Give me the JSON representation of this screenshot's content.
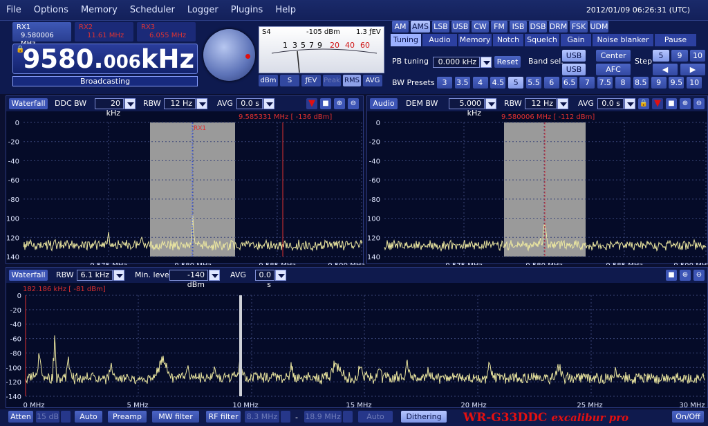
{
  "menu": [
    "File",
    "Options",
    "Memory",
    "Scheduler",
    "Logger",
    "Plugins",
    "Help"
  ],
  "clock": "2012/01/09 06:26:31 (UTC)",
  "receivers": [
    {
      "name": "RX1",
      "freq": "9.580006 MHz",
      "active": true
    },
    {
      "name": "RX2",
      "freq": "11.61 MHz",
      "active": false
    },
    {
      "name": "RX3",
      "freq": "6.055 MHz",
      "active": false
    }
  ],
  "frequency": {
    "main": "9580.",
    "fraction": "006",
    "unit": "kHz"
  },
  "mode_label": "Broadcasting",
  "smeter": {
    "s_reading": "S4",
    "dbm": "-105 dBm",
    "fev": "1.3 ƒEV",
    "scale": [
      "1",
      "3",
      "5",
      "7",
      "9",
      "20",
      "40",
      "60"
    ],
    "buttons": [
      {
        "label": "dBm",
        "state": "normal"
      },
      {
        "label": "S",
        "state": "normal"
      },
      {
        "label": "ƒEV",
        "state": "normal"
      },
      {
        "label": "Peak",
        "state": "dim"
      },
      {
        "label": "RMS",
        "state": "on"
      },
      {
        "label": "AVG",
        "state": "normal"
      }
    ]
  },
  "modes": [
    {
      "label": "AM",
      "on": false
    },
    {
      "label": "AMS",
      "on": true
    },
    {
      "label": "LSB",
      "on": false
    },
    {
      "label": "USB",
      "on": false
    },
    {
      "label": "CW",
      "on": false
    },
    {
      "label": "FM",
      "on": false
    },
    {
      "label": "ISB",
      "on": false
    },
    {
      "label": "DSB",
      "on": false
    },
    {
      "label": "DRM",
      "on": false
    },
    {
      "label": "FSK",
      "on": false
    },
    {
      "label": "UDM",
      "on": false
    }
  ],
  "tabs": [
    {
      "label": "Tuning",
      "on": true
    },
    {
      "label": "Audio",
      "on": false
    },
    {
      "label": "Memory",
      "on": false
    },
    {
      "label": "Notch",
      "on": false
    },
    {
      "label": "Squelch",
      "on": false
    },
    {
      "label": "Gain",
      "on": false
    },
    {
      "label": "Noise blanker",
      "on": false
    },
    {
      "label": "Pause",
      "on": false
    }
  ],
  "tuning": {
    "pb_label": "PB tuning",
    "pb_value": "0.000 kHz",
    "reset": "Reset",
    "bandsel_label": "Band sel.",
    "usb1": "USB",
    "usb2": "USB",
    "center": "Center",
    "afc": "AFC",
    "step_label": "Step",
    "steps": [
      "5",
      "9",
      "10"
    ],
    "left_arrow": "◀",
    "right_arrow": "▶",
    "bw_label": "BW Presets",
    "bw_presets": [
      "3",
      "3.5",
      "4",
      "4.5",
      "5",
      "5.5",
      "6",
      "6.5",
      "7",
      "7.5",
      "8",
      "8.5",
      "9",
      "9.5",
      "10"
    ],
    "bw_selected": "5"
  },
  "ddc_panel": {
    "waterfall": "Waterfall",
    "bw_label": "DDC BW",
    "bw_value": "20 kHz",
    "rbw_label": "RBW",
    "rbw_value": "12 Hz",
    "avg_label": "AVG",
    "avg_value": "0.0 s",
    "marker": "9.585331 MHz [ -136 dBm]",
    "tag": "RX1",
    "y_labels": [
      "0",
      "-20",
      "-40",
      "-60",
      "-80",
      "-100",
      "-120",
      "-140"
    ],
    "x_labels": [
      "9.575 MHz",
      "9.580 MHz",
      "9.585 MHz",
      "9.590 MHz"
    ]
  },
  "dem_panel": {
    "audio": "Audio",
    "bw_label": "DEM BW",
    "bw_value": "5.000 kHz",
    "rbw_label": "RBW",
    "rbw_value": "12 Hz",
    "avg_label": "AVG",
    "avg_value": "0.0 s",
    "marker": "9.580006 MHz [ -112 dBm]",
    "y_labels": [
      "0",
      "-20",
      "-40",
      "-60",
      "-80",
      "-100",
      "-120",
      "-140"
    ],
    "x_labels": [
      "9.575 MHz",
      "9.580 MHz",
      "9.585 MHz",
      "9.590 MHz"
    ]
  },
  "wide_panel": {
    "waterfall": "Waterfall",
    "rbw_label": "RBW",
    "rbw_value": "6.1 kHz",
    "min_label": "Min. level",
    "min_value": "-140 dBm",
    "avg_label": "AVG",
    "avg_value": "0.0 s",
    "marker": "182.186 kHz [ -81 dBm]",
    "y_labels": [
      "0",
      "-20",
      "-40",
      "-60",
      "-80",
      "-100",
      "-120",
      "-140"
    ],
    "x_labels": [
      "0 MHz",
      "5 MHz",
      "10 MHz",
      "15 MHz",
      "20 MHz",
      "25 MHz",
      "30 MHz"
    ]
  },
  "bottom": {
    "atten": "Atten",
    "atten_value": "15 dB",
    "auto": "Auto",
    "preamp": "Preamp",
    "mw": "MW filter",
    "rf": "RF filter",
    "rf_from": "8.3 MHz",
    "dash": "-",
    "rf_to": "18.9 MHz",
    "rf_auto": "Auto",
    "dithering": "Dithering",
    "brand1": "WR-G33DDC",
    "brand2": "excalibur pro",
    "onoff": "On/Off"
  },
  "colors": {
    "trace": "#ece7a0",
    "marker": "#e03030",
    "passband": "#9a9a9a"
  }
}
